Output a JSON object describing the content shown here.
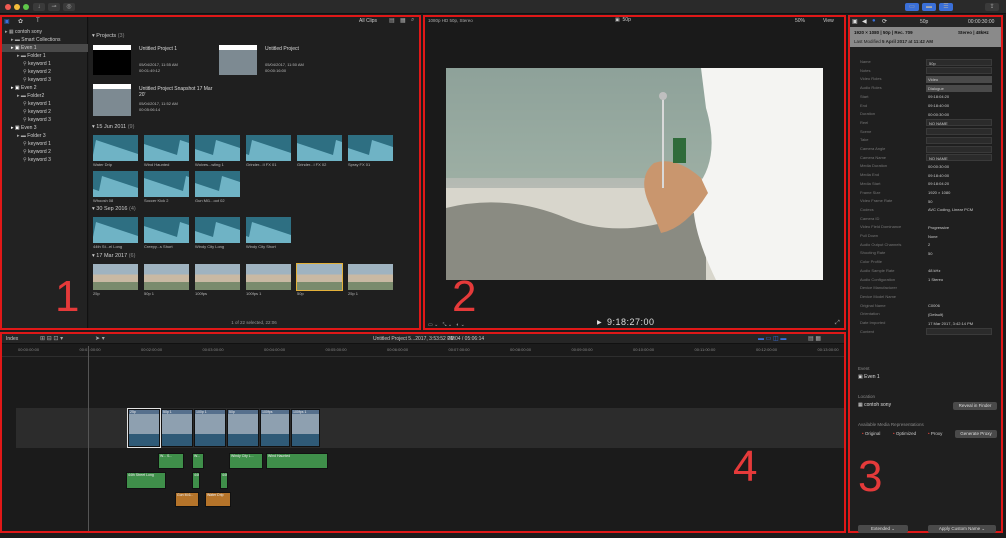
{
  "browser": {
    "filter_label": "All Clips",
    "status": "1 of 22 selected, 22:06",
    "sections": [
      {
        "title": "Projects",
        "count": "(3)"
      },
      {
        "title": "15 Jun 2011",
        "count": "(9)"
      },
      {
        "title": "30 Sep 2016",
        "count": "(4)"
      },
      {
        "title": "17 Mar 2017",
        "count": "(6)"
      }
    ],
    "projects": [
      {
        "name": "Untitled Project 1",
        "date": "05/04/2017, 11:55 AM",
        "duration": "00:01:49:12"
      },
      {
        "name": "Untitled Project",
        "date": "05/04/2017, 11:50 AM",
        "duration": "00:00:16:00"
      },
      {
        "name": "Untitled Project Snapshot 17 Mar 20'",
        "date": "05/04/2017, 11:52 AM",
        "duration": "00:05:06:14"
      }
    ],
    "clips_2011": [
      "Water Drip",
      "Wind Haunted",
      "Wolves...wling 1",
      "Grinder...II FX 01",
      "Grinder...I FX 02",
      "Spray FX 01",
      "Whoosh 08",
      "Soccer Kick 2",
      "Gun Mi1...oot 02"
    ],
    "clips_2016": [
      "44th St...el Long",
      "Creepy...s Short",
      "Windy City Long",
      "Windy City Short"
    ],
    "clips_2017": [
      "25p",
      "50p 1",
      "100fps",
      "100fps 1",
      "50p",
      "25p 1"
    ]
  },
  "viewer": {
    "format": "1080p HD 50p, Stereo",
    "clip_name": "50p",
    "zoom": "50%",
    "view_label": "View",
    "timecode": "9:18:27:00"
  },
  "inspector": {
    "clip_name": "50p",
    "duration": "00:00:30:00",
    "spec": "1920 × 1080 | 50p | Rec. 709",
    "audio_spec": "Stereo | 48kHz",
    "last_modified_label": "Last Modified",
    "last_modified": "5 April 2017 at 11:42 AM",
    "fields": [
      {
        "label": "Name",
        "value": "50p",
        "style": "box"
      },
      {
        "label": "Notes",
        "value": "",
        "style": "box"
      },
      {
        "label": "Video Roles",
        "value": "Video",
        "style": "menu"
      },
      {
        "label": "Audio Roles",
        "value": "Dialogue",
        "style": "menu"
      },
      {
        "label": "Start",
        "value": "09:18:04:20",
        "style": "plain"
      },
      {
        "label": "End",
        "value": "09:18:40:00",
        "style": "plain"
      },
      {
        "label": "Duration",
        "value": "00:00:30:00",
        "style": "plain"
      },
      {
        "label": "Reel",
        "value": "NO NAME",
        "style": "box"
      },
      {
        "label": "Scene",
        "value": "",
        "style": "box"
      },
      {
        "label": "Take",
        "value": "",
        "style": "box"
      },
      {
        "label": "Camera Angle",
        "value": "",
        "style": "box"
      },
      {
        "label": "Camera Name",
        "value": "NO NAME",
        "style": "box"
      },
      {
        "label": "Media Duration",
        "value": "00:00:30:00",
        "style": "plain"
      },
      {
        "label": "Media End",
        "value": "09:18:40:00",
        "style": "plain"
      },
      {
        "label": "Media Start",
        "value": "09:18:04:20",
        "style": "plain"
      },
      {
        "label": "Frame Size",
        "value": "1920 × 1080",
        "style": "plain"
      },
      {
        "label": "Video Frame Rate",
        "value": "50",
        "style": "plain"
      },
      {
        "label": "Codecs",
        "value": "AVC Coding, Linear PCM",
        "style": "plain"
      },
      {
        "label": "Camera ID",
        "value": "",
        "style": "plain"
      },
      {
        "label": "Video Field Dominance",
        "value": "Progressive",
        "style": "plain"
      },
      {
        "label": "Pull Down",
        "value": "None",
        "style": "plain"
      },
      {
        "label": "Audio Output Channels",
        "value": "2",
        "style": "plain"
      },
      {
        "label": "Shooting Rate",
        "value": "50",
        "style": "plain"
      },
      {
        "label": "Color Profile",
        "value": "",
        "style": "plain"
      },
      {
        "label": "Audio Sample Rate",
        "value": "48 kHz",
        "style": "plain"
      },
      {
        "label": "Audio Configuration",
        "value": "1 Stereo",
        "style": "plain"
      },
      {
        "label": "Device Manufacturer",
        "value": "",
        "style": "plain"
      },
      {
        "label": "Device Model Name",
        "value": "",
        "style": "plain"
      },
      {
        "label": "Original Name",
        "value": "C0006",
        "style": "plain"
      },
      {
        "label": "Orientation",
        "value": "(Default)",
        "style": "plain"
      },
      {
        "label": "Date Imported",
        "value": "17 Mar 2017, 3:42:14 PM",
        "style": "plain"
      },
      {
        "label": "Content",
        "value": "",
        "style": "box"
      }
    ],
    "event_label": "Event",
    "event_name": "Even 1",
    "location_label": "Location",
    "location_name": "contoh sony",
    "reveal_button": "Reveal in Finder",
    "media_reps_label": "Available Media Representations",
    "rep_original": "Original",
    "rep_optimized": "Optimized",
    "rep_proxy": "Proxy",
    "generate_proxy_button": "Generate Proxy",
    "extended_label": "Extended",
    "apply_name_label": "Apply Custom Name"
  },
  "library": {
    "items": [
      {
        "label": "contoh sony",
        "indent": 0,
        "icon": "library-icon"
      },
      {
        "label": "Smart Collections",
        "indent": 1,
        "icon": "folder-icon"
      },
      {
        "label": "Even 1",
        "indent": 1,
        "icon": "event-icon",
        "selected": true
      },
      {
        "label": "Folder 1",
        "indent": 2,
        "icon": "folder-icon"
      },
      {
        "label": "keyword 1",
        "indent": 3,
        "icon": "key-icon"
      },
      {
        "label": "keyword 2",
        "indent": 3,
        "icon": "key-icon"
      },
      {
        "label": "keyword 3",
        "indent": 3,
        "icon": "key-icon"
      },
      {
        "label": "Even 2",
        "indent": 1,
        "icon": "event-icon"
      },
      {
        "label": "Folder2",
        "indent": 2,
        "icon": "folder-icon"
      },
      {
        "label": "keyword 1",
        "indent": 3,
        "icon": "key-icon"
      },
      {
        "label": "keyword 2",
        "indent": 3,
        "icon": "key-icon"
      },
      {
        "label": "keyword 3",
        "indent": 3,
        "icon": "key-icon"
      },
      {
        "label": "Even 3",
        "indent": 1,
        "icon": "event-icon"
      },
      {
        "label": "Folder 3",
        "indent": 2,
        "icon": "folder-icon"
      },
      {
        "label": "keyword 1",
        "indent": 3,
        "icon": "key-icon"
      },
      {
        "label": "keyword 2",
        "indent": 3,
        "icon": "key-icon"
      },
      {
        "label": "keyword 3",
        "indent": 3,
        "icon": "key-icon"
      }
    ]
  },
  "timeline": {
    "index_label": "Index",
    "project_info": "Untitled Project 5...2017, 3:53:52 PM",
    "duration_info": "32:04 / 05:06:14",
    "ruler": [
      "00:00:00:00",
      "00:01:00:00",
      "00:02:00:00",
      "00:03:00:00",
      "00:04:00:00",
      "00:05:00:00",
      "00:06:00:00",
      "00:07:00:00",
      "00:08:00:00",
      "00:09:00:00",
      "00:10:00:00",
      "00:11:00:00",
      "00:12:00:00",
      "00:13:00:00"
    ],
    "video_clips": [
      "25p",
      "50p 1",
      "100p 1",
      "50p",
      "100fps",
      "100fps 1"
    ],
    "audio_clips_green": [
      "W... S...",
      "W...",
      "Windy City L...",
      "Wind Haunted"
    ],
    "audio_clip_long": "44th Street Long",
    "audio_clips_orange": [
      "Gun M.6...",
      "Water Drip"
    ]
  },
  "regions": [
    "1",
    "2",
    "3",
    "4"
  ],
  "colors": {
    "region_border": "#e01818",
    "waveform": "#2e6f82",
    "audio_green": "#3f8f4a",
    "audio_orange": "#b5742a",
    "video_clip": "#56708d",
    "accent_blue": "#3a6fd8"
  }
}
